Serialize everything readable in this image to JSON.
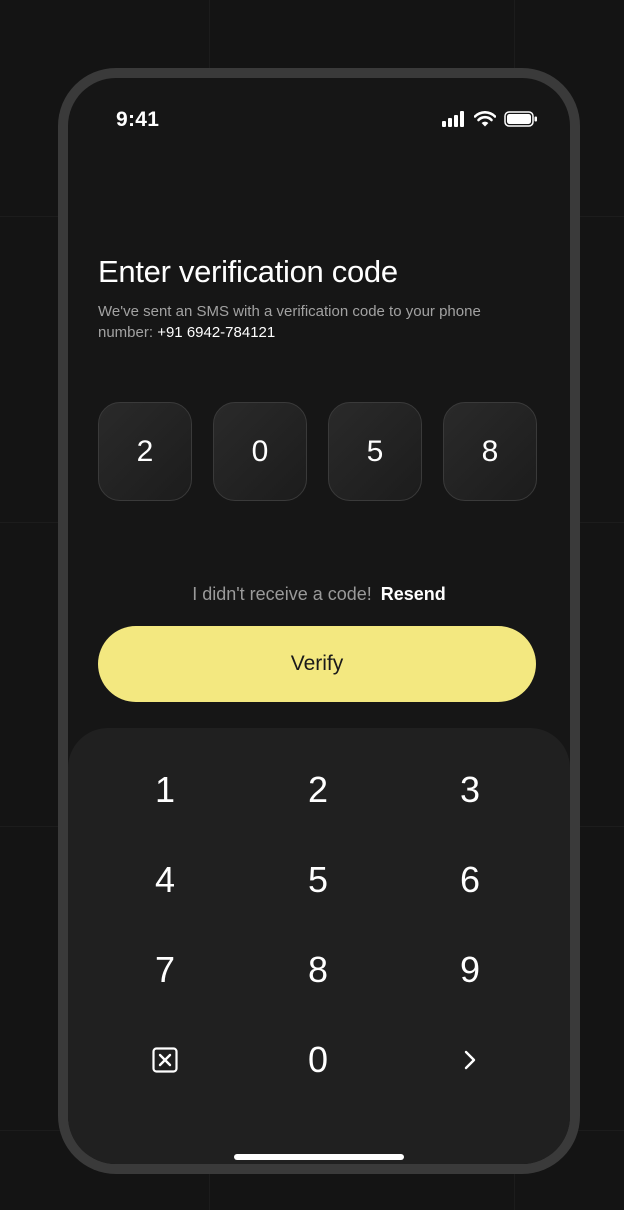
{
  "status_bar": {
    "time": "9:41",
    "icons": [
      "signal-icon",
      "wifi-icon",
      "battery-icon"
    ]
  },
  "title": "Enter verification code",
  "subtitle": {
    "text": "We've sent an SMS with a verification code to your phone number:",
    "phone_number": "+91 6942-784121"
  },
  "otp": {
    "digits": [
      "2",
      "0",
      "5",
      "8"
    ]
  },
  "resend": {
    "prompt": "I didn't receive a code!",
    "link_label": "Resend"
  },
  "verify_button": {
    "label": "Verify"
  },
  "keypad": {
    "keys": [
      "1",
      "2",
      "3",
      "4",
      "5",
      "6",
      "7",
      "8",
      "9",
      "0"
    ],
    "delete_icon": "backspace-icon",
    "next_icon": "chevron-right-icon"
  },
  "colors": {
    "background": "#141414",
    "accent": "#f3e880",
    "text_primary": "#ffffff",
    "text_secondary": "#a2a2a2"
  }
}
